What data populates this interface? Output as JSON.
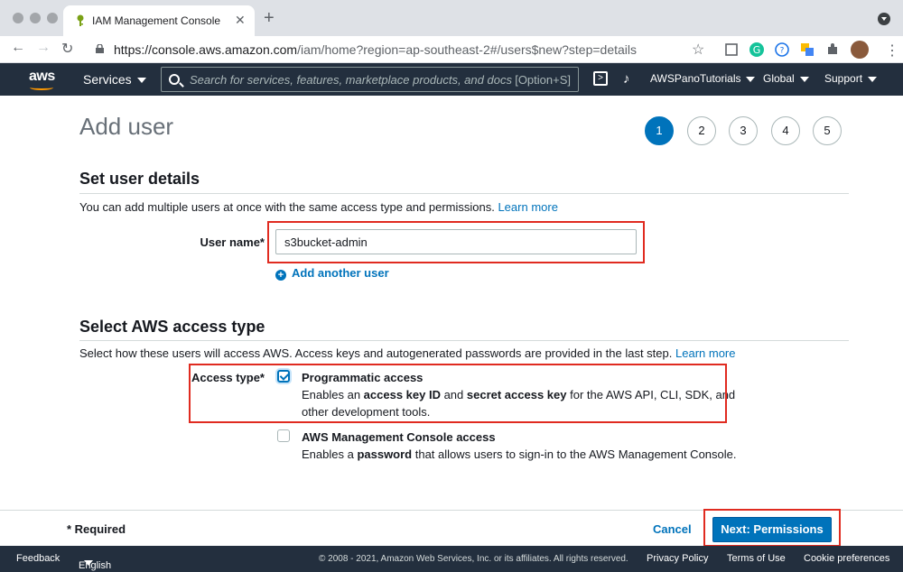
{
  "browser": {
    "tab_title": "IAM Management Console",
    "tab_close": "✕",
    "new_tab": "+",
    "url_domain": "https://console.aws.amazon.com",
    "url_path": "/iam/home?region=ap-southeast-2#/users$new?step=details"
  },
  "aws_nav": {
    "logo": "aws",
    "services_label": "Services",
    "search_placeholder": "Search for services, features, marketplace products, and docs",
    "search_shortcut": "[Option+S]",
    "account_label": "AWSPanoTutorials",
    "region_label": "Global",
    "support_label": "Support"
  },
  "page": {
    "title": "Add user",
    "steps": [
      "1",
      "2",
      "3",
      "4",
      "5"
    ],
    "active_step": "1"
  },
  "user_details": {
    "section_title": "Set user details",
    "description": "You can add multiple users at once with the same access type and permissions.",
    "learn_more": "Learn more",
    "username_label": "User name*",
    "username_value": "s3bucket-admin",
    "add_another_user": "Add another user"
  },
  "access_type": {
    "section_title": "Select AWS access type",
    "description": "Select how these users will access AWS. Access keys and autogenerated passwords are provided in the last step.",
    "learn_more": "Learn more",
    "label": "Access type*",
    "programmatic": {
      "title": "Programmatic access",
      "desc_1": "Enables an ",
      "desc_b1": "access key ID",
      "desc_2": " and ",
      "desc_b2": "secret access key",
      "desc_3": " for the AWS API, CLI, SDK, and",
      "desc_4": "other development tools.",
      "checked": true
    },
    "console": {
      "title": "AWS Management Console access",
      "desc_1": "Enables a ",
      "desc_b1": "password",
      "desc_2": " that allows users to sign-in to the AWS Management Console.",
      "checked": false
    }
  },
  "actions": {
    "required_note": "* Required",
    "cancel": "Cancel",
    "next": "Next: Permissions"
  },
  "footer": {
    "feedback": "Feedback",
    "language": "English (US)",
    "copyright": "© 2008 - 2021, Amazon Web Services, Inc. or its affiliates. All rights reserved.",
    "privacy": "Privacy Policy",
    "terms": "Terms of Use",
    "cookies": "Cookie preferences"
  },
  "colors": {
    "aws_nav_bg": "#232f3e",
    "accent_blue": "#0073bb",
    "highlight_red": "#e02b20",
    "aws_orange": "#ff9900"
  }
}
